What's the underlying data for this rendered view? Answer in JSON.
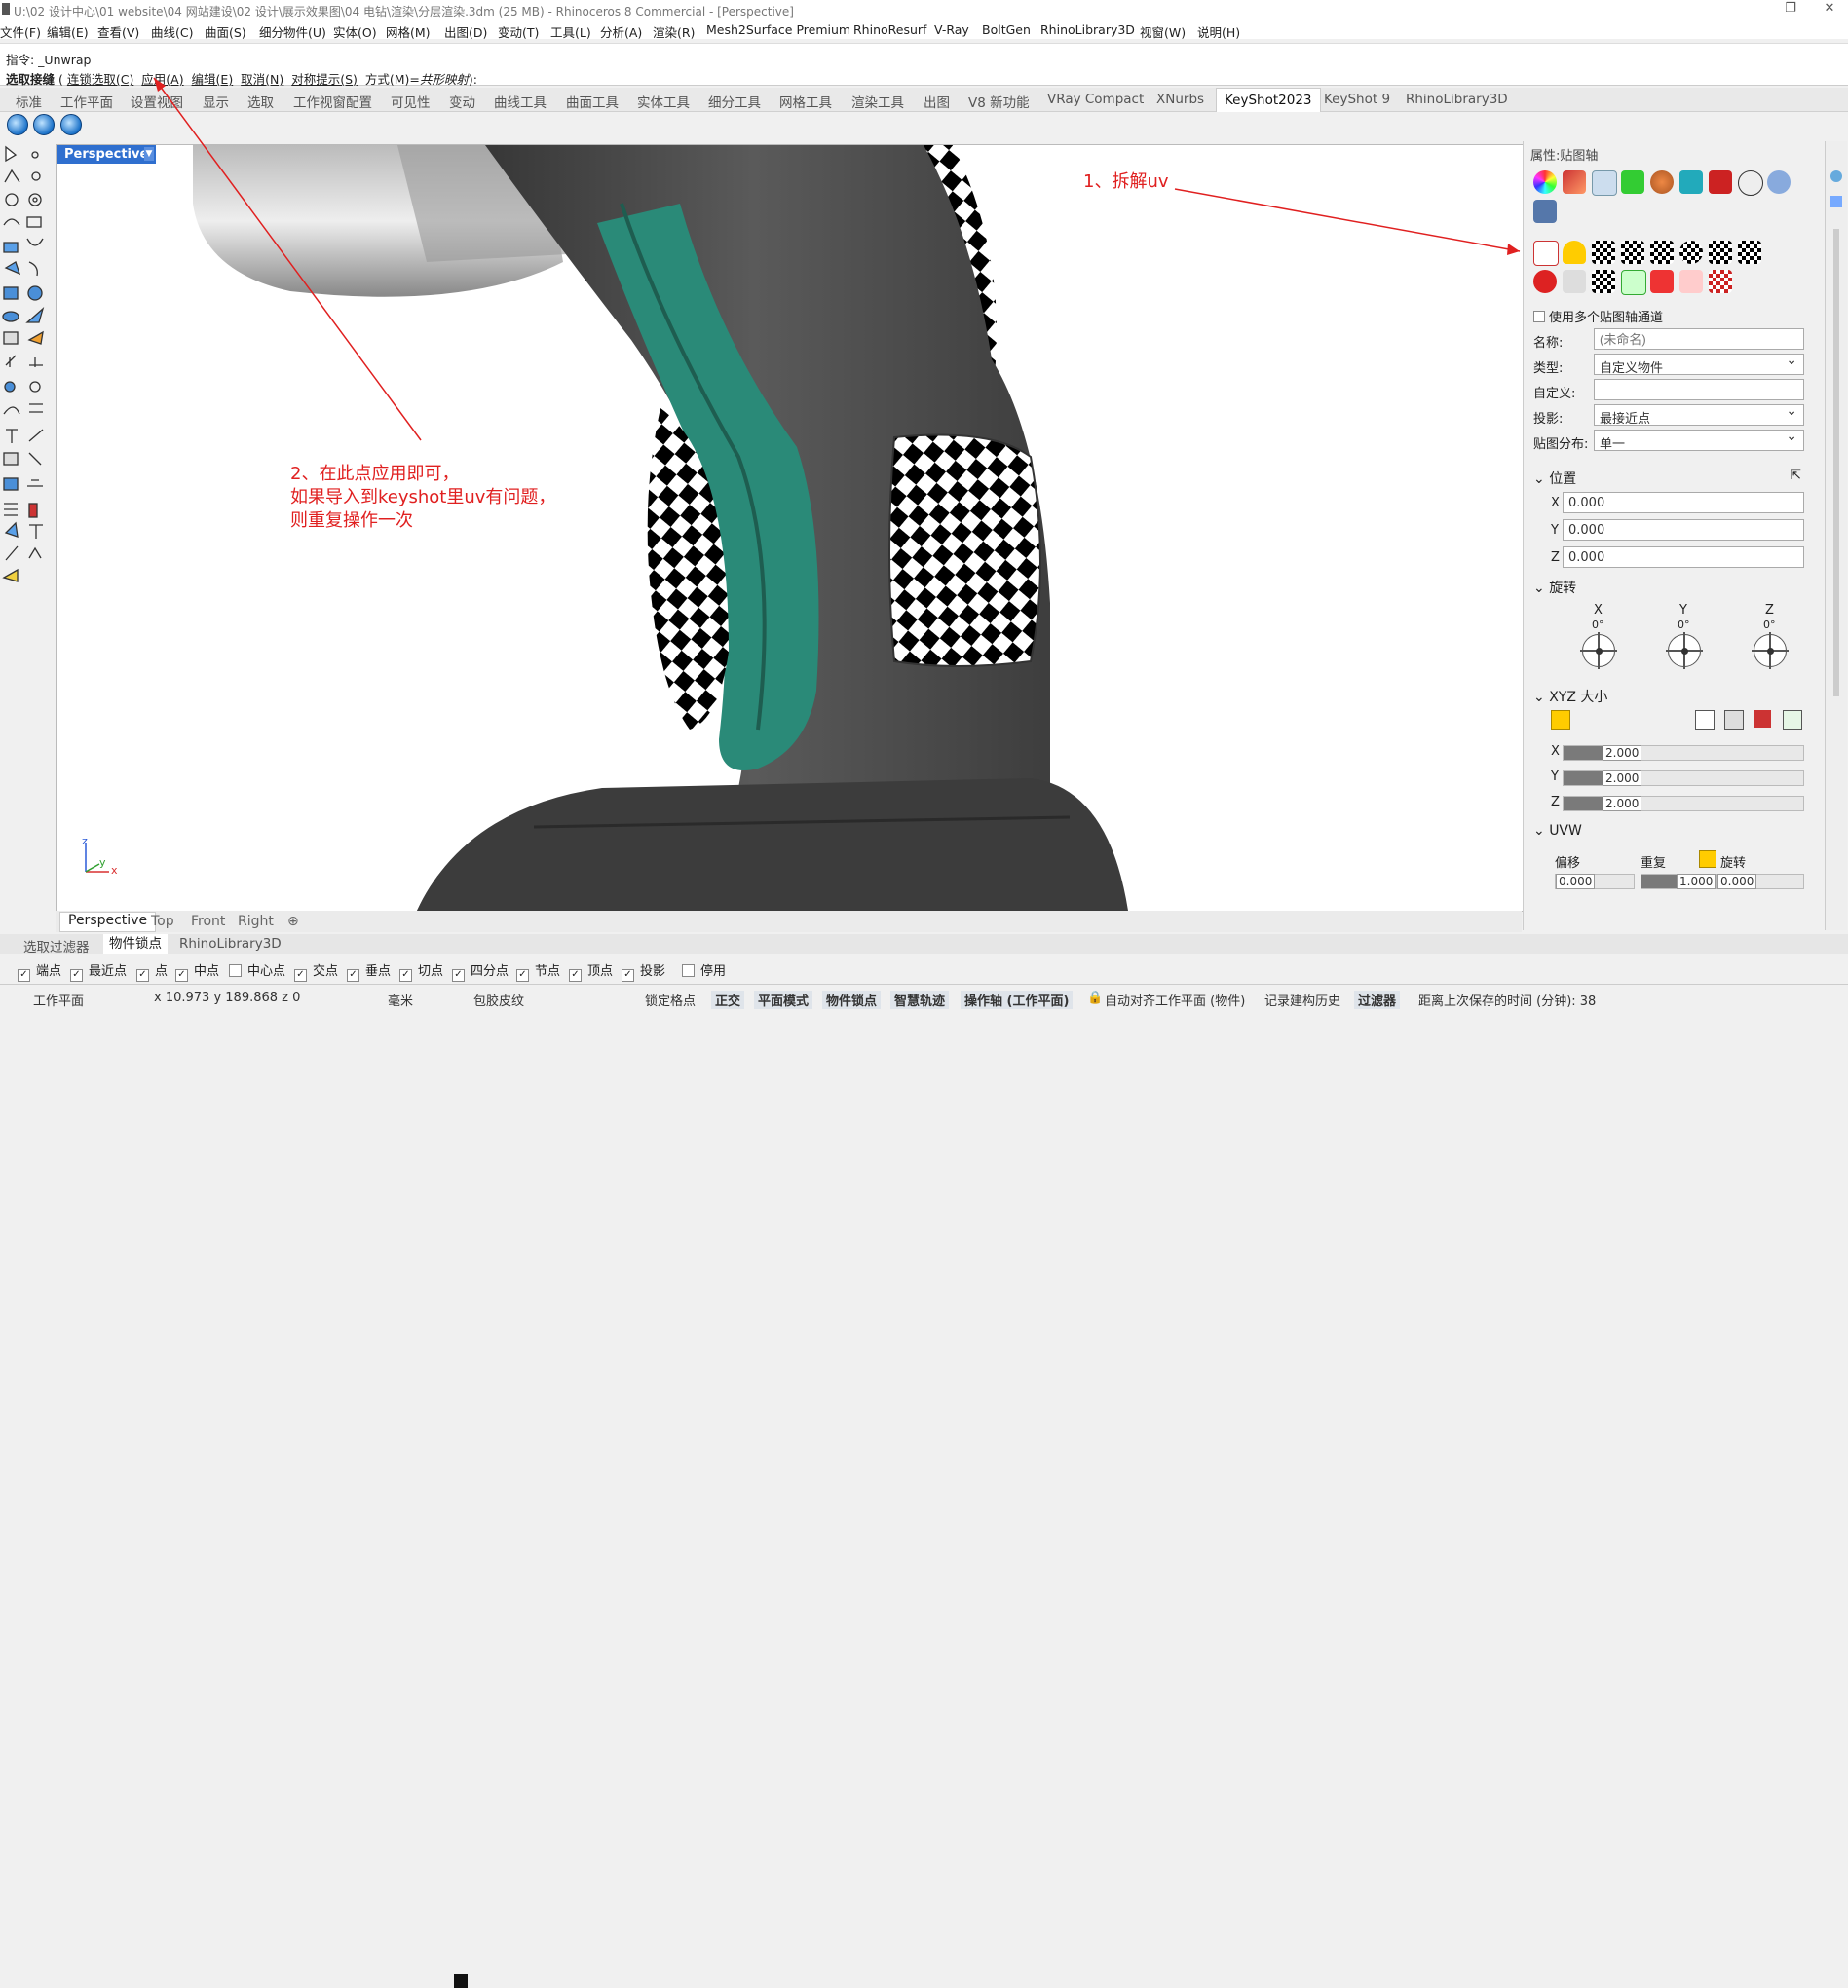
{
  "titlebar": {
    "title": "U:\\02 设计中心\\01 website\\04 网站建设\\02 设计\\展示效果图\\04 电钻\\渲染\\分层渲染.3dm (25 MB) - Rhinoceros 8 Commercial - [Perspective]",
    "restore": "❐",
    "close": "✕"
  },
  "menu": [
    "文件(F)",
    "编辑(E)",
    "查看(V)",
    "曲线(C)",
    "曲面(S)",
    "细分物件(U)",
    "实体(O)",
    "网格(M)",
    "出图(D)",
    "变动(T)",
    "工具(L)",
    "分析(A)",
    "渲染(R)",
    "Mesh2Surface Premium",
    "RhinoResurf",
    "V-Ray",
    "BoltGen",
    "RhinoLibrary3D",
    "视窗(W)",
    "说明(H)"
  ],
  "command": {
    "line1": "指令: _Unwrap",
    "prompt": "选取接缝",
    "options": [
      "连锁选取(C)",
      "应用(A)",
      "编辑(E)",
      "取消(N)",
      "对称提示(S)"
    ],
    "mode_label": "方式(M)=",
    "mode_value": "共形映射",
    "suffix": "):"
  },
  "tabs": [
    "标准",
    "工作平面",
    "设置视图",
    "显示",
    "选取",
    "工作视窗配置",
    "可见性",
    "变动",
    "曲线工具",
    "曲面工具",
    "实体工具",
    "细分工具",
    "网格工具",
    "渲染工具",
    "出图",
    "V8 新功能",
    "VRay Compact",
    "XNurbs",
    "KeyShot2023",
    "KeyShot 9",
    "RhinoLibrary3D"
  ],
  "active_tab": "KeyShot2023",
  "viewport": {
    "name": "Perspective",
    "axes": {
      "x": "x",
      "y": "y",
      "z": "z"
    },
    "annotation1": "1、拆解uv",
    "annotation2_lines": [
      "2、在此点应用即可，",
      "如果导入到keyshot里uv有问题，",
      "则重复操作一次"
    ]
  },
  "viewport_tabs": [
    "Perspective",
    "Top",
    "Front",
    "Right",
    "⊕"
  ],
  "panel_tabs": [
    "选取过滤器",
    "物件锁点",
    "RhinoLibrary3D"
  ],
  "snaps": [
    {
      "label": "端点",
      "checked": true
    },
    {
      "label": "最近点",
      "checked": true
    },
    {
      "label": "点",
      "checked": true
    },
    {
      "label": "中点",
      "checked": true
    },
    {
      "label": "中心点",
      "checked": false
    },
    {
      "label": "交点",
      "checked": true
    },
    {
      "label": "垂点",
      "checked": true
    },
    {
      "label": "切点",
      "checked": true
    },
    {
      "label": "四分点",
      "checked": true
    },
    {
      "label": "节点",
      "checked": true
    },
    {
      "label": "顶点",
      "checked": true
    },
    {
      "label": "投影",
      "checked": true
    },
    {
      "label": "停用",
      "checked": false
    }
  ],
  "status": {
    "cplane": "工作平面",
    "coords": "x 10.973    y 189.868    z 0",
    "units": "毫米",
    "layer": "包胶皮纹",
    "lock_grid": "锁定格点",
    "ortho": "正交",
    "planar": "平面模式",
    "osnap": "物件锁点",
    "smarttrack": "智慧轨迹",
    "gumball": "操作轴 (工作平面)",
    "autoalign": "自动对齐工作平面 (物件)",
    "history": "记录建构历史",
    "filter": "过滤器",
    "save_time": "距离上次保存的时间 (分钟): 38"
  },
  "props": {
    "header": "属性:贴图轴",
    "multi_channel": "使用多个贴图轴通道",
    "name_label": "名称:",
    "name_placeholder": "(未命名)",
    "type_label": "类型:",
    "type_value": "自定义物件",
    "custom_label": "自定义:",
    "custom_value": "",
    "projection_label": "投影:",
    "projection_value": "最接近点",
    "distribution_label": "贴图分布:",
    "distribution_value": "单一",
    "position_title": "位置",
    "pos": [
      {
        "axis": "X",
        "value": "0.000"
      },
      {
        "axis": "Y",
        "value": "0.000"
      },
      {
        "axis": "Z",
        "value": "0.000"
      }
    ],
    "rotation_title": "旋转",
    "rot": [
      {
        "axis": "X",
        "value": "0°"
      },
      {
        "axis": "Y",
        "value": "0°"
      },
      {
        "axis": "Z",
        "value": "0°"
      }
    ],
    "size_title": "XYZ 大小",
    "size": [
      {
        "axis": "X",
        "value": "2.000"
      },
      {
        "axis": "Y",
        "value": "2.000"
      },
      {
        "axis": "Z",
        "value": "2.000"
      }
    ],
    "uvw_title": "UVW",
    "uvw_cols": [
      "偏移",
      "重复",
      "旋转"
    ],
    "uvw_row1": [
      "0.000",
      "1.000",
      "0.000"
    ]
  },
  "colors": {
    "accent": "#2f6fcf",
    "annotation": "#e02020",
    "teal": "#2a8a78",
    "body": "#4a4a4a"
  }
}
